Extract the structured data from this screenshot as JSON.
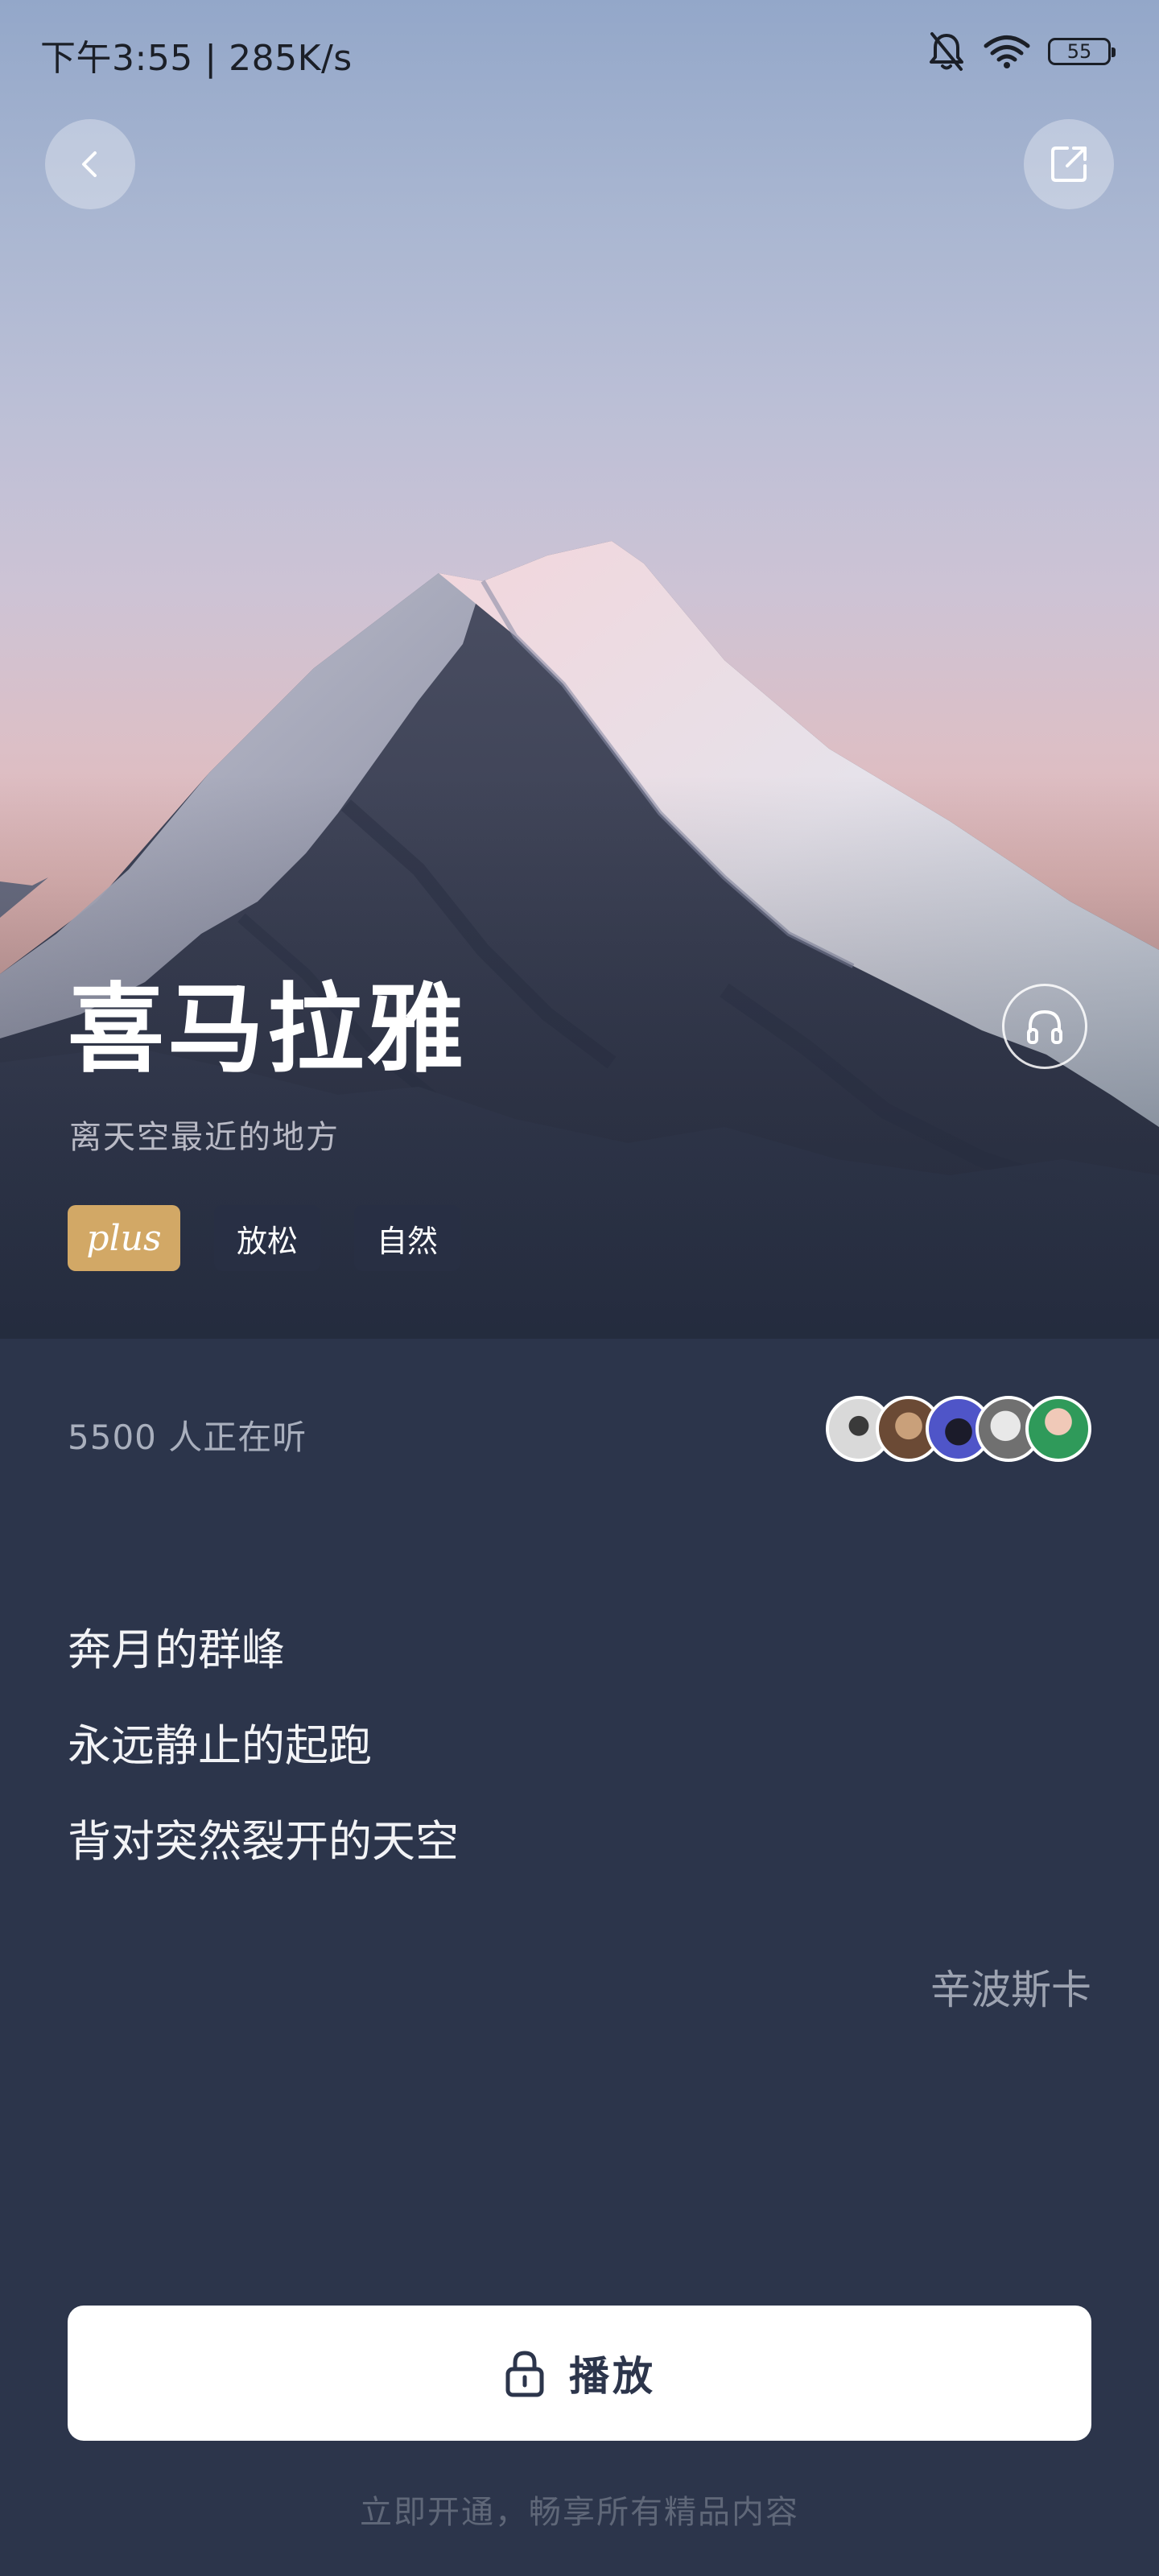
{
  "status_bar": {
    "time": "下午3:55 | 285K/s",
    "battery": "55"
  },
  "header": {
    "back_icon": "chevron-left-icon",
    "share_icon": "share-icon"
  },
  "hero": {
    "title": "喜马拉雅",
    "subtitle": "离天空最近的地方",
    "listen_icon": "headphones-icon",
    "tags": [
      "plus",
      "放松",
      "自然"
    ]
  },
  "listeners": {
    "text": "5500 人正在听"
  },
  "poem": {
    "lines": [
      "奔月的群峰",
      "永远静止的起跑",
      "背对突然裂开的天空"
    ],
    "author": "辛波斯卡"
  },
  "play_button": {
    "label": "播放",
    "icon": "lock-icon"
  },
  "promo": {
    "text": "立即开通，畅享所有精品内容"
  },
  "colors": {
    "background": "#2c354b",
    "plus_tag": "#d2a866",
    "button": "#ffffff"
  }
}
